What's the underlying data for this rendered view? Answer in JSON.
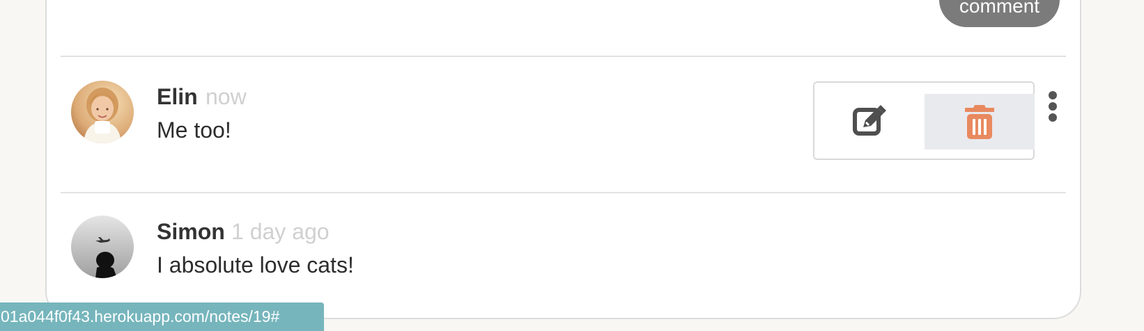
{
  "composer": {
    "submit_label": "comment"
  },
  "comments": [
    {
      "author": "Elin",
      "time": "now",
      "text": "Me too!",
      "avatar": "woman-with-cup-avatar"
    },
    {
      "author": "Simon",
      "time": "1 day ago",
      "text": "I absolute love cats!",
      "avatar": "man-looking-at-plane-avatar"
    }
  ],
  "actions": {
    "edit_icon": "edit-icon",
    "delete_icon": "trash-icon",
    "menu_icon": "more-vertical-icon"
  },
  "colors": {
    "delete_accent": "#e8895f",
    "status_bar": "#76b5bc",
    "submit_button": "#7b7b7b"
  },
  "status_bar": {
    "url": "01a044f0f43.herokuapp.com/notes/19#"
  }
}
